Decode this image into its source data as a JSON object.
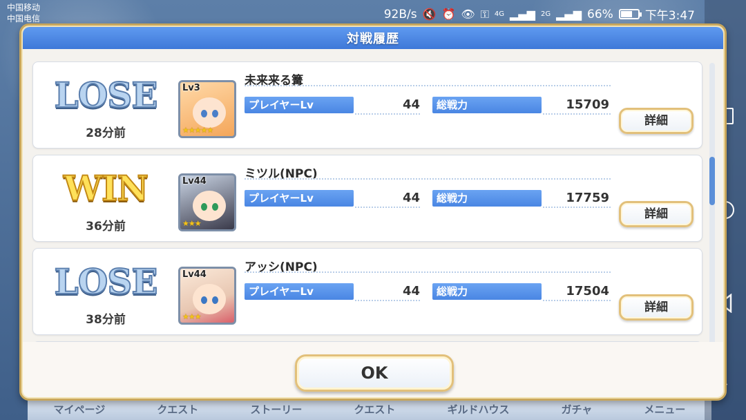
{
  "status_bar": {
    "carrier1": "中国移动",
    "carrier2": "中国电信",
    "speed": "92B/s",
    "network1": "4G",
    "network2": "2G",
    "battery": "66%",
    "battery_level": 0.66,
    "time": "下午3:47",
    "icons": [
      "mute-icon",
      "alarm-icon",
      "eye-icon",
      "key-icon",
      "signal-icon",
      "battery-icon"
    ]
  },
  "background_tabs": [
    "マイページ",
    "クエスト",
    "ストーリー",
    "クエスト",
    "ギルドハウス",
    "ガチャ",
    "メニュー"
  ],
  "dialog": {
    "title": "対戦履歴",
    "ok_label": "OK"
  },
  "battles": [
    {
      "result": "LOSE",
      "time_ago": "28分前",
      "portrait_level": "Lv3",
      "player_name": "未来来る篝",
      "player_lv_label": "プレイヤーLv",
      "player_lv": "44",
      "power_label": "総戦力",
      "power": "15709",
      "detail_label": "詳細",
      "stars": "★★★★★"
    },
    {
      "result": "WIN",
      "time_ago": "36分前",
      "portrait_level": "Lv44",
      "player_name": "ミツル(NPC)",
      "player_lv_label": "プレイヤーLv",
      "player_lv": "44",
      "power_label": "総戦力",
      "power": "17759",
      "detail_label": "詳細",
      "stars": "★★★"
    },
    {
      "result": "LOSE",
      "time_ago": "38分前",
      "portrait_level": "Lv44",
      "player_name": "アッシ(NPC)",
      "player_lv_label": "プレイヤーLv",
      "player_lv": "44",
      "power_label": "総戦力",
      "power": "17504",
      "detail_label": "詳細",
      "stars": "★★★"
    }
  ],
  "colors": {
    "header_blue": "#4a86e3",
    "gold_border": "#e2c07a",
    "win_yellow": "#ffe15a",
    "lose_blue": "#b9d4f0"
  }
}
